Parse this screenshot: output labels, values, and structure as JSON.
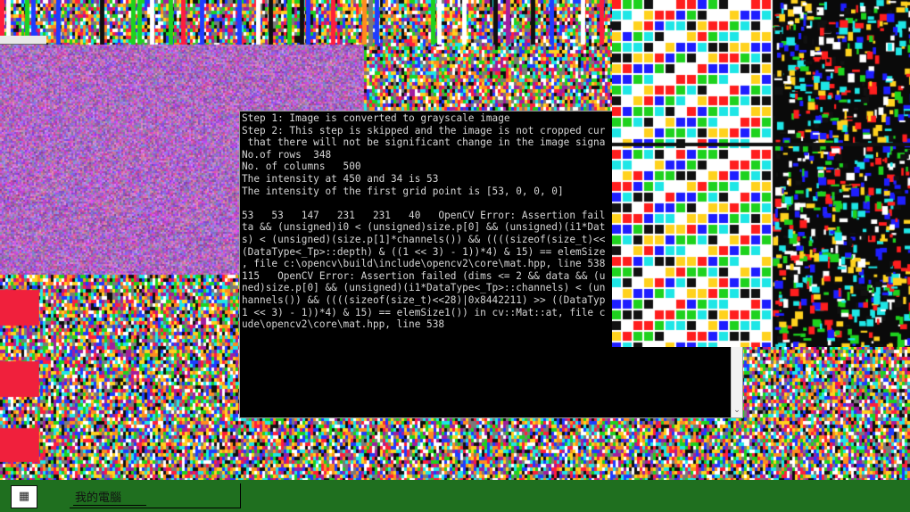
{
  "console": {
    "lines": [
      "Step 1: Image is converted to grayscale image",
      "Step 2: This step is skipped and the image is not cropped cur",
      " that there will not be significant change in the image signa",
      "No.of rows  348",
      "No. of columns   500",
      "The intensity at 450 and 34 is 53",
      "The intensity of the first grid point is [53, 0, 0, 0]",
      "",
      "53   53   147   231   231   40   OpenCV Error: Assertion fail",
      "ta && (unsigned)i0 < (unsigned)size.p[0] && (unsigned)(i1*Dat",
      "s) < (unsigned)(size.p[1]*channels()) && ((((sizeof(size_t)<<",
      "(DataType<_Tp>::depth) & ((1 << 3) - 1))*4) & 15) == elemSize",
      ", file c:\\opencv\\build\\include\\opencv2\\core\\mat.hpp, line 538",
      "115   OpenCV Error: Assertion failed (dims <= 2 && data && (u",
      "ned)size.p[0] && (unsigned)(i1*DataType<_Tp>::channels) < (un",
      "hannels()) && ((((sizeof(size_t)<<28)|0x8442211) >> ((DataTyp",
      "1 << 3) - 1))*4) & 15) == elemSize1()) in cv::Mat::at, file c",
      "ude\\opencv2\\core\\mat.hpp, line 538"
    ],
    "scroll_arrow_icon": "chevron-down-icon"
  },
  "taskbar": {
    "start_icon": "windows-logo-icon",
    "task_label": "我的電腦",
    "task_icon": "computer-icon"
  },
  "colors": {
    "taskbar": "#1f6f1f",
    "console_bg": "#000000",
    "console_text": "#d6d6d6"
  }
}
